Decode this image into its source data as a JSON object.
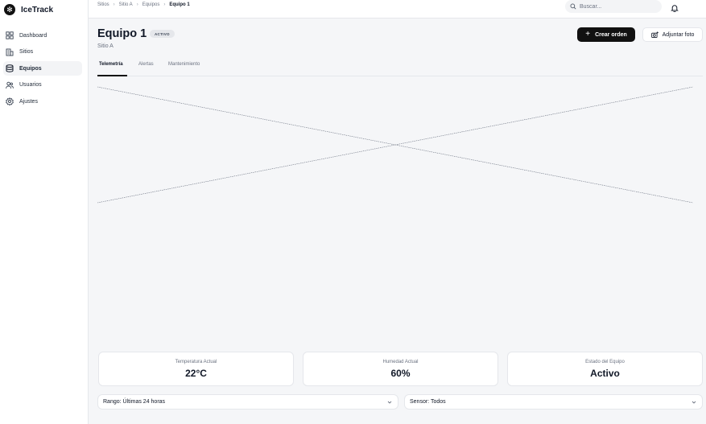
{
  "brand": {
    "name": "IceTrack"
  },
  "sidebar": {
    "items": [
      {
        "label": "Dashboard",
        "icon": "dashboard-icon"
      },
      {
        "label": "Sitios",
        "icon": "building-icon"
      },
      {
        "label": "Equipos",
        "icon": "database-icon",
        "active": true
      },
      {
        "label": "Usuarios",
        "icon": "users-icon"
      },
      {
        "label": "Ajustes",
        "icon": "gear-icon"
      }
    ]
  },
  "breadcrumb": {
    "items": [
      "Sitios",
      "Sitio A",
      "Equipos"
    ],
    "current": "Equipo 1"
  },
  "search": {
    "placeholder": "Buscar..."
  },
  "header": {
    "title": "Equipo 1",
    "badge": "ACTIVO",
    "subtitle": "Sitio A",
    "create_order": "Crear orden",
    "attach_photo": "Adjuntar foto"
  },
  "tabs": [
    {
      "label": "Telemetría",
      "active": true
    },
    {
      "label": "Alertas"
    },
    {
      "label": "Mantenimiento"
    }
  ],
  "metrics": [
    {
      "label": "Temperatura Actual",
      "value": "22°C"
    },
    {
      "label": "Humedad Actual",
      "value": "60%"
    },
    {
      "label": "Estado del Equipo",
      "value": "Activo"
    }
  ],
  "filters": {
    "range": "Rango: Últimas 24 horas",
    "sensor": "Sensor: Todos"
  },
  "colors": {
    "accent": "#111111",
    "background": "#f5f6f8",
    "border": "#e5e7eb",
    "muted_text": "#6b7280"
  }
}
